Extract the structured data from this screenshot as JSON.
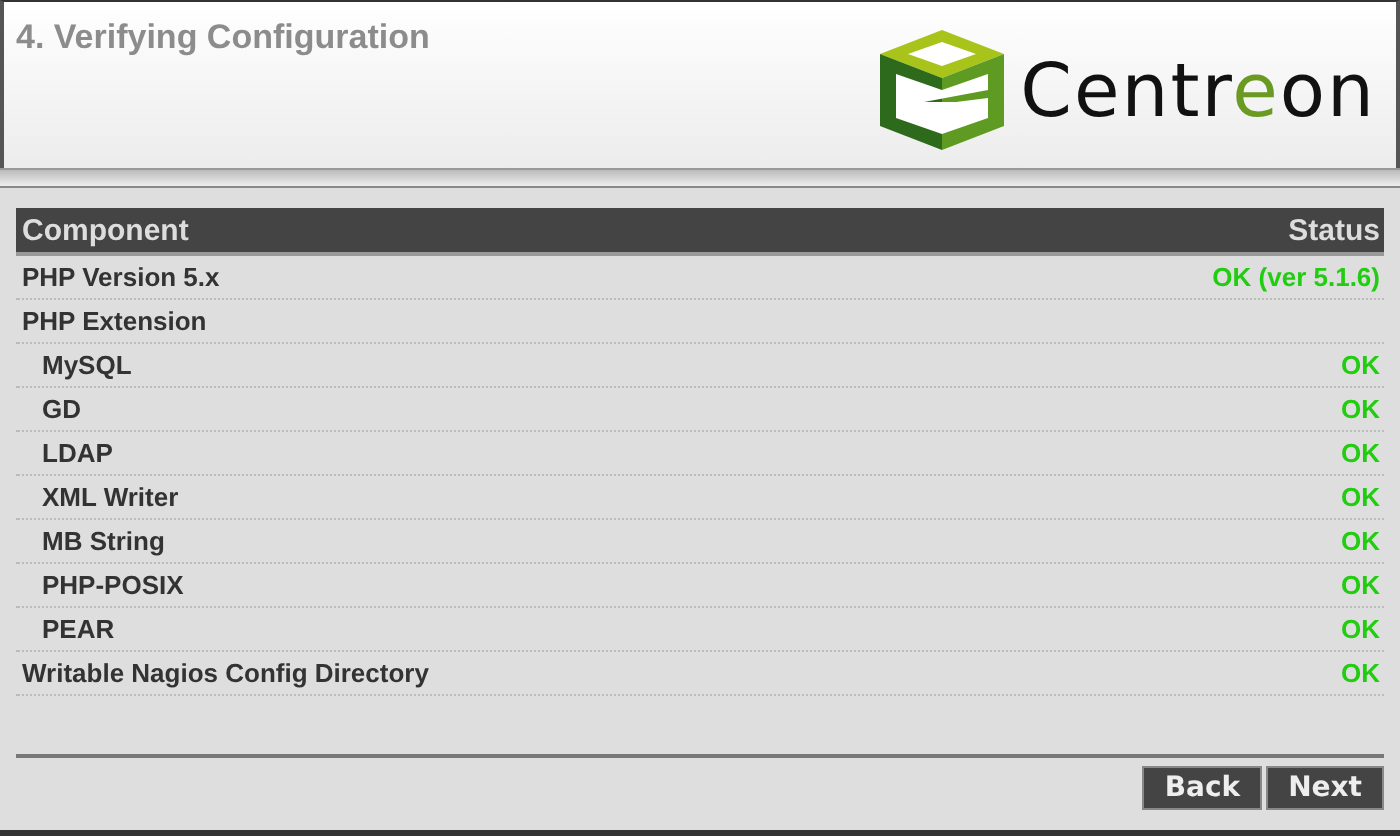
{
  "header": {
    "title": "4. Verifying Configuration",
    "logo": "Centreon"
  },
  "table": {
    "columns": [
      "Component",
      "Status"
    ],
    "rows": [
      {
        "component": "PHP Version 5.x",
        "status": "OK (ver 5.1.6)",
        "passed": true
      },
      {
        "component": "PHP Extension",
        "children": [
          {
            "component": "MySQL",
            "status": "OK",
            "passed": true
          },
          {
            "component": "GD",
            "status": "OK",
            "passed": true
          },
          {
            "component": "LDAP",
            "status": "OK",
            "passed": true
          },
          {
            "component": "XML Writer",
            "status": "OK",
            "passed": true
          },
          {
            "component": "MB String",
            "status": "OK",
            "passed": true
          },
          {
            "component": "PHP-POSIX",
            "status": "OK",
            "passed": true
          },
          {
            "component": "PEAR",
            "status": "OK",
            "passed": true
          }
        ]
      },
      {
        "component": "Writable Nagios Config Directory",
        "status": "OK",
        "passed": true
      }
    ]
  },
  "buttons": [
    "Back",
    "Next"
  ]
}
